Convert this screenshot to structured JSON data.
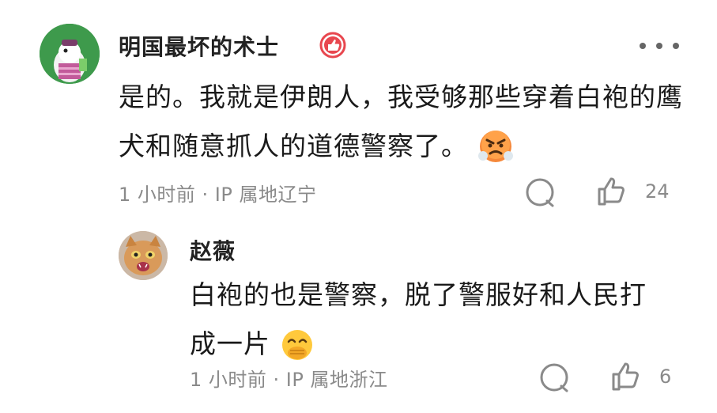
{
  "comment": {
    "author": "明国最坏的术士",
    "author_badge_icon": "thumbs-up-badge-icon",
    "text": "是的。我就是伊朗人，我受够那些穿着白袍的鹰犬和随意抓人的道德警察了。",
    "emoji": "angry-face-icon",
    "meta": "1 小时前 · IP 属地辽宁",
    "like_count": "24",
    "more_icon": "more-dots-icon"
  },
  "reply": {
    "author": "赵薇",
    "text": "白袍的也是警察，脱了警服好和人民打成一片",
    "emoji": "face-with-hand-over-mouth-icon",
    "meta": "1 小时前 · IP 属地浙江",
    "like_count": "6"
  },
  "colors": {
    "badge_red": "#e8474f",
    "meta_gray": "#8a8a8a",
    "avatar1_bg": "#3e9a4c",
    "icon_gray": "#8a8a8a"
  }
}
